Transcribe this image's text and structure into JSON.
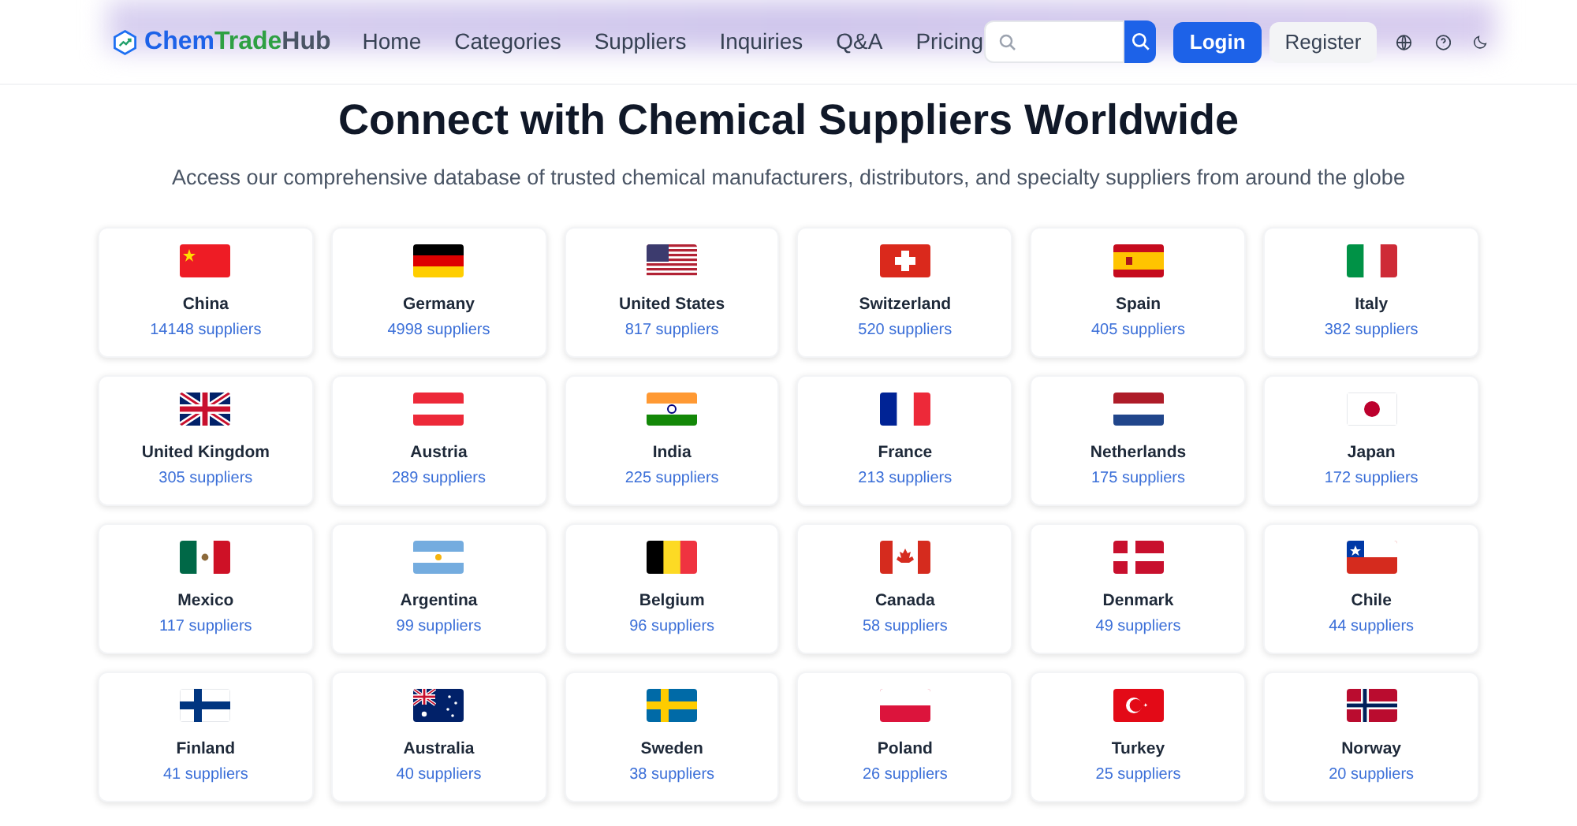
{
  "header": {
    "logo": [
      "Chem",
      "Trade",
      "Hub"
    ],
    "nav": [
      {
        "label": "Home"
      },
      {
        "label": "Categories"
      },
      {
        "label": "Suppliers"
      },
      {
        "label": "Inquiries"
      },
      {
        "label": "Q&A"
      },
      {
        "label": "Pricing"
      }
    ],
    "login": "Login",
    "register": "Register"
  },
  "title": "Connect with Chemical Suppliers Worldwide",
  "subtitle": "Access our comprehensive database of trusted chemical manufacturers, distributors, and specialty suppliers from around the globe",
  "countries": [
    {
      "name": "China",
      "count": "14148 suppliers"
    },
    {
      "name": "Germany",
      "count": "4998 suppliers"
    },
    {
      "name": "United States",
      "count": "817 suppliers"
    },
    {
      "name": "Switzerland",
      "count": "520 suppliers"
    },
    {
      "name": "Spain",
      "count": "405 suppliers"
    },
    {
      "name": "Italy",
      "count": "382 suppliers"
    },
    {
      "name": "United Kingdom",
      "count": "305 suppliers"
    },
    {
      "name": "Austria",
      "count": "289 suppliers"
    },
    {
      "name": "India",
      "count": "225 suppliers"
    },
    {
      "name": "France",
      "count": "213 suppliers"
    },
    {
      "name": "Netherlands",
      "count": "175 suppliers"
    },
    {
      "name": "Japan",
      "count": "172 suppliers"
    },
    {
      "name": "Mexico",
      "count": "117 suppliers"
    },
    {
      "name": "Argentina",
      "count": "99 suppliers"
    },
    {
      "name": "Belgium",
      "count": "96 suppliers"
    },
    {
      "name": "Canada",
      "count": "58 suppliers"
    },
    {
      "name": "Denmark",
      "count": "49 suppliers"
    },
    {
      "name": "Chile",
      "count": "44 suppliers"
    },
    {
      "name": "Finland",
      "count": "41 suppliers"
    },
    {
      "name": "Australia",
      "count": "40 suppliers"
    },
    {
      "name": "Sweden",
      "count": "38 suppliers"
    },
    {
      "name": "Poland",
      "count": "26 suppliers"
    },
    {
      "name": "Turkey",
      "count": "25 suppliers"
    },
    {
      "name": "Norway",
      "count": "20 suppliers"
    }
  ]
}
